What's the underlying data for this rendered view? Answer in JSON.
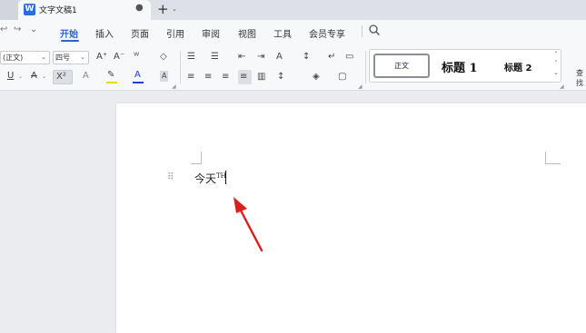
{
  "tabbar": {
    "doc_icon_letter": "W",
    "doc_title": "文字文稿1",
    "modified_dot": "●",
    "new_tab": "+",
    "new_tab_caret": "⌄"
  },
  "quick_access": {
    "undo": "↩",
    "redo": "↪",
    "more": "⌄"
  },
  "menu": {
    "items": [
      "开始",
      "插入",
      "页面",
      "引用",
      "审阅",
      "视图",
      "工具",
      "会员专享"
    ],
    "active": "开始"
  },
  "ribbon": {
    "font_name": "(正文)",
    "font_size": "四号",
    "grow_font": "A⁺",
    "shrink_font": "A⁻",
    "phonetic": "ᵂ",
    "clear_format": "◇",
    "underline": "U",
    "strikethrough": "A",
    "superscript": "X²",
    "text_effect": "A",
    "highlight": "✎",
    "font_color": "A",
    "char_shading": "A",
    "bullets": "☰",
    "numbering": "☰",
    "outdent": "⇤",
    "indent": "⇥",
    "text_direction": "A",
    "sort": "↕",
    "show_marks": "↵",
    "border_table": "▭",
    "align_left": "≡",
    "align_center": "≡",
    "align_right": "≡",
    "justify": "≡",
    "distributed": "▥",
    "line_spacing": "↕",
    "shading": "◈",
    "borders": "▢",
    "highlight_color": "#f5d400",
    "font_color_value": "#1f3fd1"
  },
  "styles": {
    "normal": "正文",
    "heading1": "标题 1",
    "heading2": "标题 2",
    "find_label": "查找"
  },
  "document": {
    "text": "今天",
    "superscript": "TH"
  },
  "colors": {
    "accent": "#2a62d9",
    "arrow": "#d9201f"
  }
}
